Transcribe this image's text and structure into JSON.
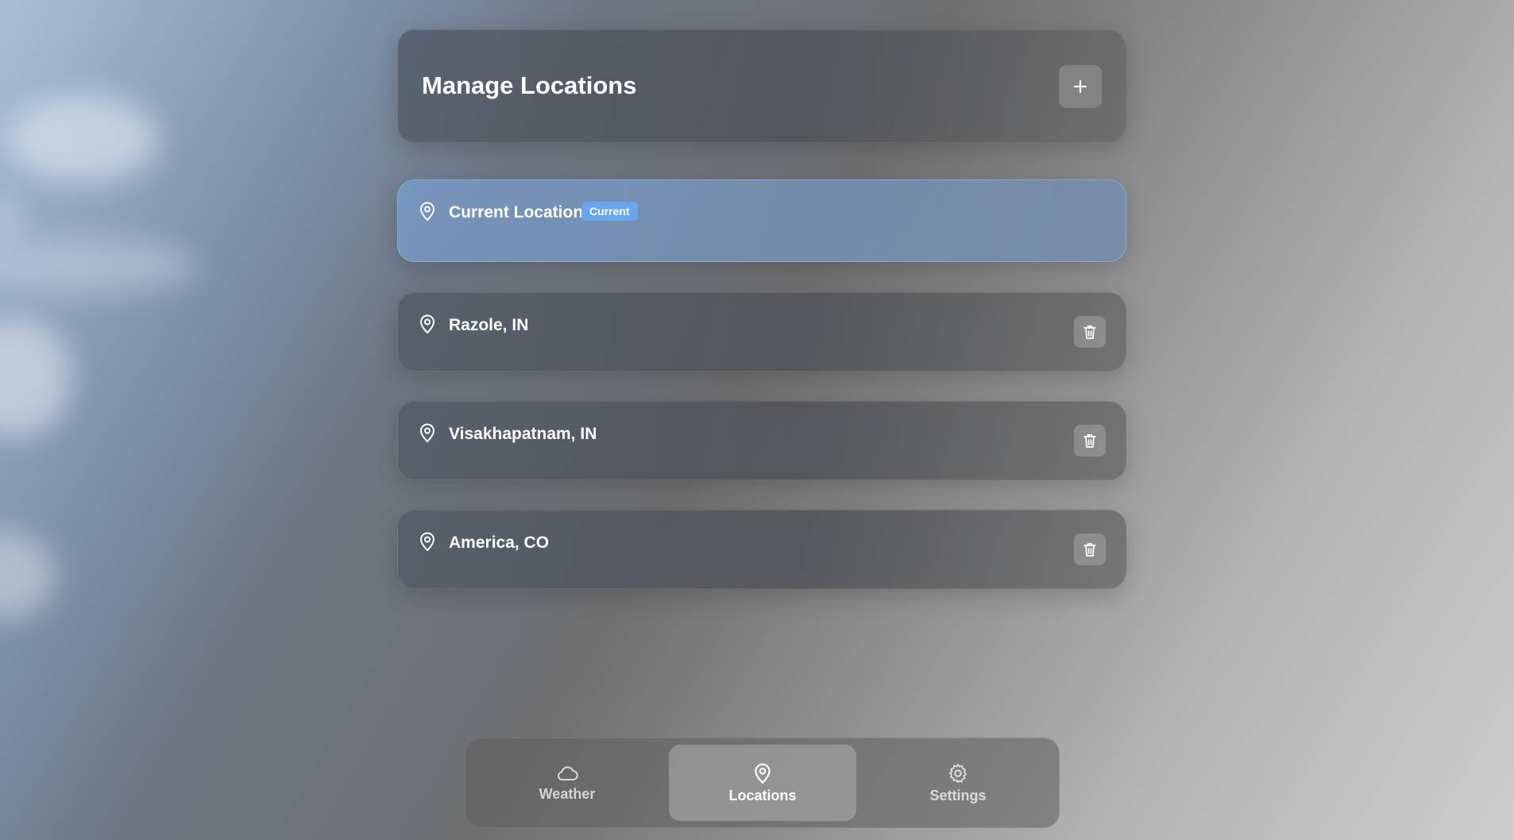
{
  "header": {
    "title": "Manage Locations"
  },
  "locations": [
    {
      "name": "Current Location",
      "badge": "Current"
    },
    {
      "name": "Razole, IN"
    },
    {
      "name": "Visakhapatnam, IN"
    },
    {
      "name": "America, CO"
    }
  ],
  "nav": {
    "items": [
      {
        "label": "Weather",
        "icon": "cloud-icon"
      },
      {
        "label": "Locations",
        "icon": "map-pin-icon"
      },
      {
        "label": "Settings",
        "icon": "gear-icon"
      }
    ],
    "active": "Locations"
  },
  "colors": {
    "current_card": "#7b98bd",
    "badge": "#6aa6ee",
    "panel": "#50585f"
  }
}
